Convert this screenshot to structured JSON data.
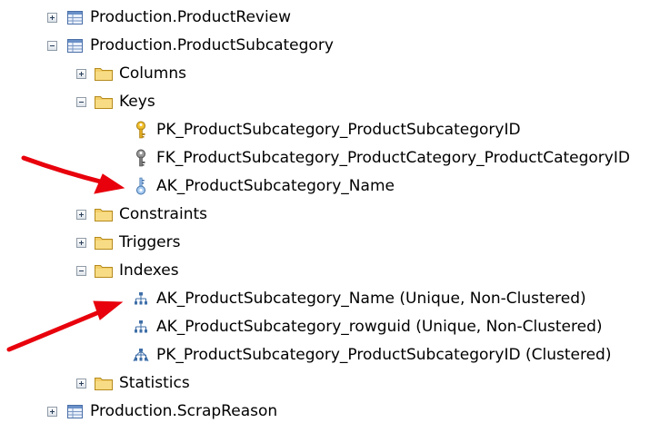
{
  "tree": {
    "nodes": [
      {
        "label": "Production.ProductReview",
        "icon": "table-icon",
        "state": "collapsed"
      },
      {
        "label": "Production.ProductSubcategory",
        "icon": "table-icon",
        "state": "expanded"
      },
      {
        "label": "Columns",
        "icon": "folder-icon",
        "state": "collapsed"
      },
      {
        "label": "Keys",
        "icon": "folder-icon",
        "state": "expanded"
      },
      {
        "label": "PK_ProductSubcategory_ProductSubcategoryID",
        "icon": "primary-key-icon"
      },
      {
        "label": "FK_ProductSubcategory_ProductCategory_ProductCategoryID",
        "icon": "foreign-key-icon"
      },
      {
        "label": "AK_ProductSubcategory_Name",
        "icon": "unique-key-icon"
      },
      {
        "label": "Constraints",
        "icon": "folder-icon",
        "state": "collapsed"
      },
      {
        "label": "Triggers",
        "icon": "folder-icon",
        "state": "collapsed"
      },
      {
        "label": "Indexes",
        "icon": "folder-icon",
        "state": "expanded"
      },
      {
        "label": "AK_ProductSubcategory_Name (Unique, Non-Clustered)",
        "icon": "nonclustered-index-icon"
      },
      {
        "label": "AK_ProductSubcategory_rowguid (Unique, Non-Clustered)",
        "icon": "nonclustered-index-icon"
      },
      {
        "label": "PK_ProductSubcategory_ProductSubcategoryID (Clustered)",
        "icon": "clustered-index-icon"
      },
      {
        "label": "Statistics",
        "icon": "folder-icon",
        "state": "collapsed"
      },
      {
        "label": "Production.ScrapReason",
        "icon": "table-icon",
        "state": "collapsed"
      }
    ]
  },
  "annotations": {
    "arrow_color": "#e8000c",
    "arrows": [
      "arrow-to-unique-key",
      "arrow-to-unique-index"
    ]
  }
}
